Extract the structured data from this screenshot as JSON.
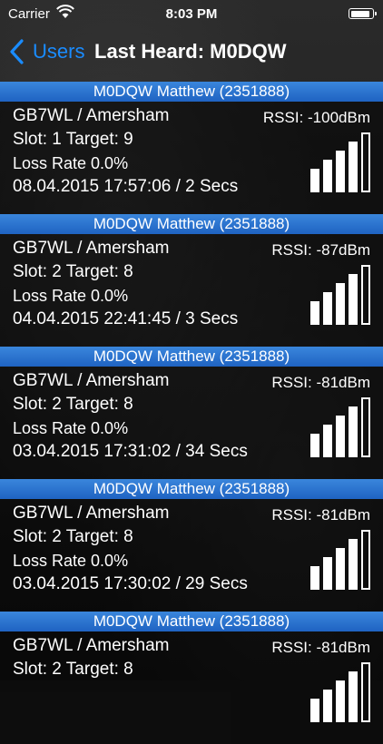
{
  "status_bar": {
    "carrier": "Carrier",
    "time": "8:03 PM",
    "battery_level": 0.95
  },
  "nav": {
    "back_label": "Users",
    "title": "Last Heard: M0DQW"
  },
  "colors": {
    "accent": "#1a8cff",
    "header_blue": "#2a74d0"
  },
  "entries": [
    {
      "header": "M0DQW Matthew (2351888)",
      "repeater": "GB7WL / Amersham",
      "rssi": "RSSI: -100dBm",
      "slot": "Slot: 1  Target: 9",
      "loss": "Loss Rate 0.0%",
      "time": "08.04.2015 17:57:06 / 2 Secs",
      "signal_bars": 4
    },
    {
      "header": "M0DQW Matthew (2351888)",
      "repeater": "GB7WL / Amersham",
      "rssi": "RSSI: -87dBm",
      "slot": "Slot: 2  Target: 8",
      "loss": "Loss Rate 0.0%",
      "time": "04.04.2015 22:41:45 / 3 Secs",
      "signal_bars": 4
    },
    {
      "header": "M0DQW Matthew (2351888)",
      "repeater": "GB7WL / Amersham",
      "rssi": "RSSI: -81dBm",
      "slot": "Slot: 2  Target: 8",
      "loss": "Loss Rate 0.0%",
      "time": "03.04.2015 17:31:02 / 34 Secs",
      "signal_bars": 4
    },
    {
      "header": "M0DQW Matthew (2351888)",
      "repeater": "GB7WL / Amersham",
      "rssi": "RSSI: -81dBm",
      "slot": "Slot: 2  Target: 8",
      "loss": "Loss Rate 0.0%",
      "time": "03.04.2015 17:30:02 / 29 Secs",
      "signal_bars": 4
    },
    {
      "header": "M0DQW Matthew (2351888)",
      "repeater": "GB7WL / Amersham",
      "rssi": "RSSI: -81dBm",
      "slot": "Slot: 2  Target: 8",
      "loss": "",
      "time": "",
      "signal_bars": 4
    }
  ]
}
